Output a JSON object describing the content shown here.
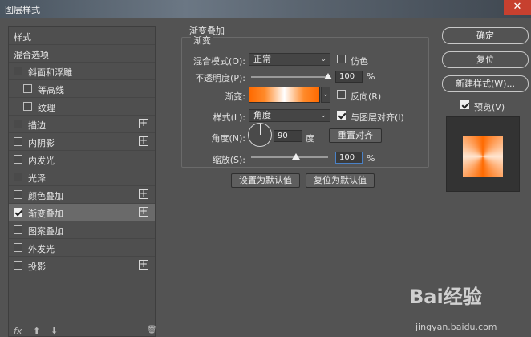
{
  "window": {
    "title": "图层样式",
    "close_glyph": "✕"
  },
  "left_panel": {
    "items": [
      {
        "label": "样式",
        "checkbox": false,
        "checked": false,
        "plus": false,
        "indent": 0
      },
      {
        "label": "混合选项",
        "checkbox": false,
        "checked": false,
        "plus": false,
        "indent": 0
      },
      {
        "label": "斜面和浮雕",
        "checkbox": true,
        "checked": false,
        "plus": false,
        "indent": 0
      },
      {
        "label": "等高线",
        "checkbox": true,
        "checked": false,
        "plus": false,
        "indent": 1
      },
      {
        "label": "纹理",
        "checkbox": true,
        "checked": false,
        "plus": false,
        "indent": 1
      },
      {
        "label": "描边",
        "checkbox": true,
        "checked": false,
        "plus": true,
        "indent": 0
      },
      {
        "label": "内阴影",
        "checkbox": true,
        "checked": false,
        "plus": true,
        "indent": 0
      },
      {
        "label": "内发光",
        "checkbox": true,
        "checked": false,
        "plus": false,
        "indent": 0
      },
      {
        "label": "光泽",
        "checkbox": true,
        "checked": false,
        "plus": false,
        "indent": 0
      },
      {
        "label": "颜色叠加",
        "checkbox": true,
        "checked": false,
        "plus": true,
        "indent": 0
      },
      {
        "label": "渐变叠加",
        "checkbox": true,
        "checked": true,
        "plus": true,
        "indent": 0,
        "selected": true
      },
      {
        "label": "图案叠加",
        "checkbox": true,
        "checked": false,
        "plus": false,
        "indent": 0
      },
      {
        "label": "外发光",
        "checkbox": true,
        "checked": false,
        "plus": false,
        "indent": 0
      },
      {
        "label": "投影",
        "checkbox": true,
        "checked": false,
        "plus": true,
        "indent": 0
      }
    ],
    "footer": {
      "fx_label": "fx",
      "up_glyph": "⬆",
      "down_glyph": "⬇",
      "trash_glyph": "🗑"
    }
  },
  "gradient_overlay": {
    "section_title": "渐变叠加",
    "group_title": "渐变",
    "blend_mode_label": "混合模式(O):",
    "blend_mode_value": "正常",
    "dither_label": "仿色",
    "dither_checked": false,
    "opacity_label": "不透明度(P):",
    "opacity_value": "100",
    "opacity_unit": "%",
    "opacity_fraction": 1.0,
    "gradient_label": "渐变:",
    "reverse_label": "反向(R)",
    "reverse_checked": false,
    "style_label": "样式(L):",
    "style_value": "角度",
    "align_layer_label": "与图层对齐(I)",
    "align_layer_checked": true,
    "angle_label": "角度(N):",
    "angle_value": "90",
    "angle_unit": "度",
    "reset_align_label": "重置对齐",
    "scale_label": "缩放(S):",
    "scale_value": "100",
    "scale_unit": "%",
    "scale_fraction": 0.4,
    "set_default_label": "设置为默认值",
    "reset_default_label": "复位为默认值",
    "colors": {
      "orange": "#ff6a00",
      "white": "#ffffff"
    }
  },
  "right_panel": {
    "ok_label": "确定",
    "reset_label": "复位",
    "new_style_label": "新建样式(W)...",
    "preview_label": "预览(V)",
    "preview_checked": true
  },
  "watermark": {
    "brand": "Bai经验",
    "url": "jingyan.baidu.com"
  }
}
